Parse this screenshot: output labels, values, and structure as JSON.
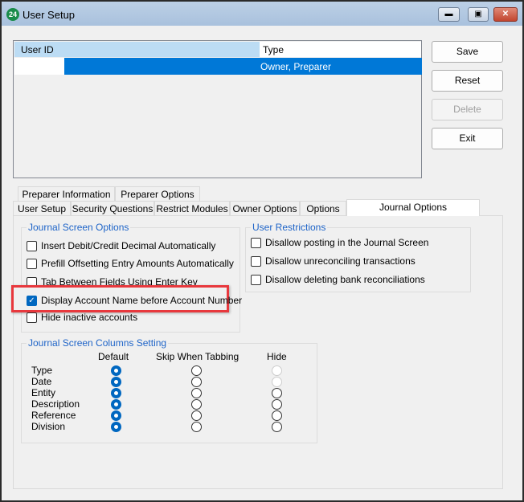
{
  "window": {
    "title": "User Setup",
    "logo_text": "24"
  },
  "users_table": {
    "columns": [
      "User ID",
      "Type"
    ],
    "rows": [
      {
        "user_id": "",
        "type": "Owner, Preparer",
        "selected": true
      }
    ]
  },
  "buttons": {
    "save": "Save",
    "reset": "Reset",
    "delete": "Delete",
    "exit": "Exit"
  },
  "tabs": {
    "row1": [
      "Preparer Information",
      "Preparer Options"
    ],
    "row2": [
      "User Setup",
      "Security Questions",
      "Restrict Modules",
      "Owner Options",
      "Options",
      "Journal Options"
    ],
    "active": "Journal Options"
  },
  "journal_screen_options": {
    "title": "Journal Screen Options",
    "items": [
      {
        "label": "Insert Debit/Credit Decimal Automatically",
        "checked": false
      },
      {
        "label": "Prefill Offsetting Entry Amounts Automatically",
        "checked": false
      },
      {
        "label": "Tab Between Fields Using Enter Key",
        "checked": false
      },
      {
        "label": "Display Account Name before Account Number",
        "checked": true
      },
      {
        "label": "Hide inactive accounts",
        "checked": false
      }
    ]
  },
  "user_restrictions": {
    "title": "User Restrictions",
    "items": [
      {
        "label": "Disallow posting in the Journal Screen",
        "checked": false
      },
      {
        "label": "Disallow unreconciling transactions",
        "checked": false
      },
      {
        "label": "Disallow deleting bank reconciliations",
        "checked": false
      }
    ]
  },
  "columns_setting": {
    "title": "Journal Screen Columns Setting",
    "headers": [
      "Default",
      "Skip When Tabbing",
      "Hide"
    ],
    "rows": [
      {
        "label": "Type",
        "selected": "Default",
        "hide_disabled": true
      },
      {
        "label": "Date",
        "selected": "Default",
        "hide_disabled": true
      },
      {
        "label": "Entity",
        "selected": "Default",
        "hide_disabled": false
      },
      {
        "label": "Description",
        "selected": "Default",
        "hide_disabled": false
      },
      {
        "label": "Reference",
        "selected": "Default",
        "hide_disabled": false
      },
      {
        "label": "Division",
        "selected": "Default",
        "hide_disabled": false
      }
    ]
  },
  "colors": {
    "accent": "#0078d7",
    "highlight": "#e8383d",
    "group_title": "#1e64c8"
  }
}
